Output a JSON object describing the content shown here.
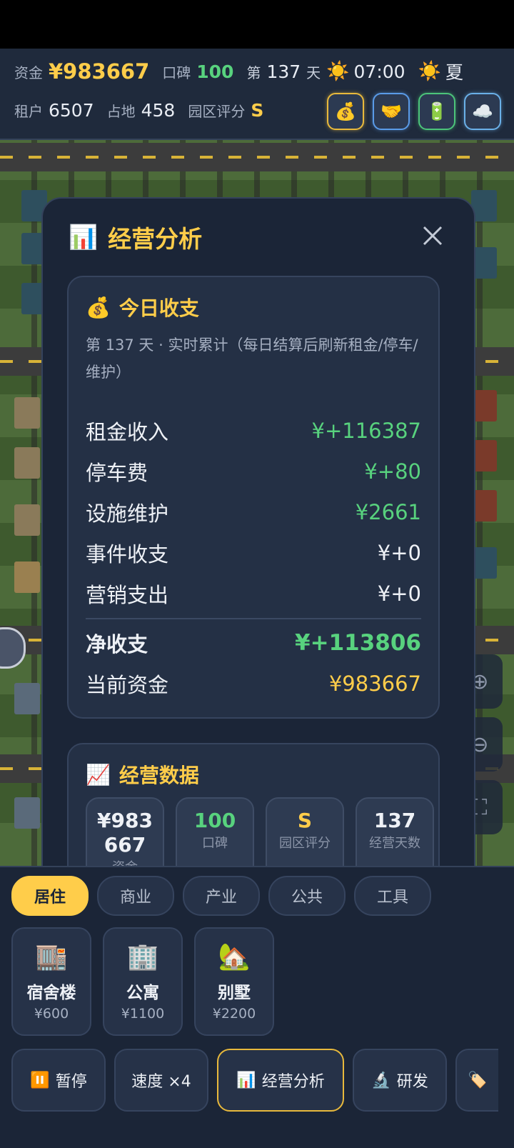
{
  "hud": {
    "funds_label": "资金",
    "funds_value": "¥983667",
    "reputation_label": "口碑",
    "reputation_value": "100",
    "day_prefix": "第",
    "day_value": "137",
    "day_suffix": "天",
    "time": "07:00",
    "season": "夏",
    "tenants_label": "租户",
    "tenants_value": "6507",
    "land_label": "占地",
    "land_value": "458",
    "rating_label": "园区评分",
    "rating_value": "S"
  },
  "panel": {
    "title": "经营分析",
    "today": {
      "title": "今日收支",
      "subtitle": "第 137 天 · 实时累计（每日结算后刷新租金/停车/维护）",
      "rows": [
        {
          "label": "租金收入",
          "value": "¥+116387"
        },
        {
          "label": "停车费",
          "value": "¥+80"
        },
        {
          "label": "设施维护",
          "value": "¥2661"
        },
        {
          "label": "事件收支",
          "value": "¥+0"
        },
        {
          "label": "营销支出",
          "value": "¥+0"
        }
      ],
      "net_label": "净收支",
      "net_value": "¥+113806",
      "current_label": "当前资金",
      "current_value": "¥983667"
    },
    "data": {
      "title": "经营数据",
      "stats": [
        {
          "value": "¥983667",
          "label": "资金"
        },
        {
          "value": "100",
          "label": "口碑"
        },
        {
          "value": "S",
          "label": "园区评分"
        },
        {
          "value": "137",
          "label": "经营天数"
        }
      ]
    }
  },
  "tabs": [
    "居住",
    "商业",
    "产业",
    "公共",
    "工具"
  ],
  "buildings": [
    {
      "name": "宿舍楼",
      "price": "¥600",
      "icon": "dorm-icon"
    },
    {
      "name": "公寓",
      "price": "¥1100",
      "icon": "apartment-icon"
    },
    {
      "name": "别墅",
      "price": "¥2200",
      "icon": "villa-icon"
    }
  ],
  "actions": {
    "pause": "暂停",
    "speed": "速度 ×4",
    "analysis": "经营分析",
    "research": "研发"
  },
  "colors": {
    "accent": "#ffcd4a",
    "positive": "#58d27e",
    "panel": "#1b2537"
  }
}
